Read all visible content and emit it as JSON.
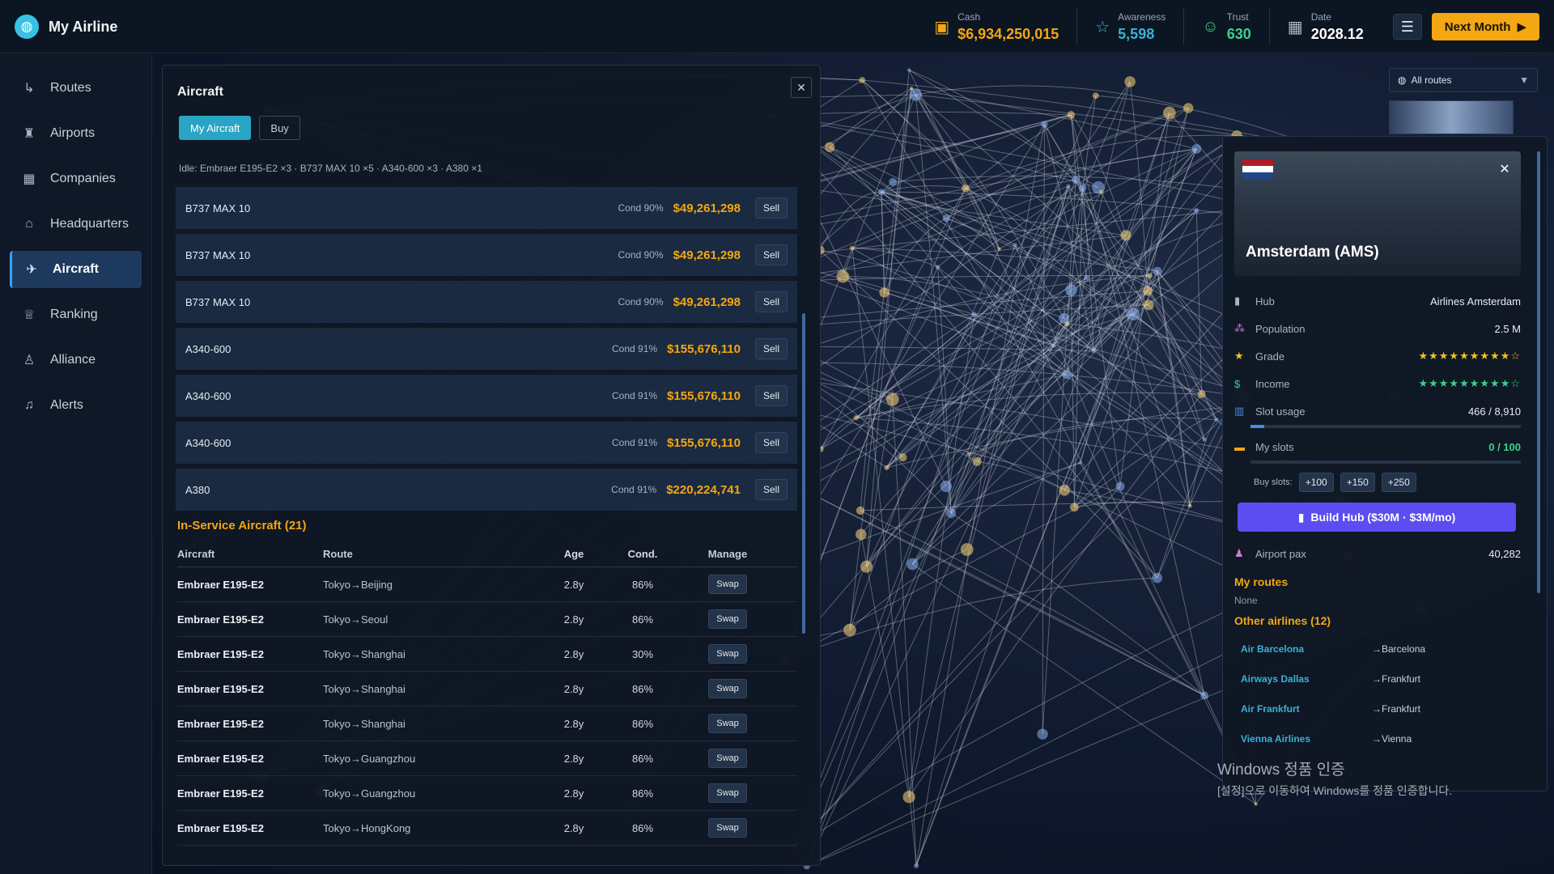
{
  "app": {
    "title": "My Airline"
  },
  "stats": {
    "cash": {
      "label": "Cash",
      "value": "$6,934,250,015",
      "color": "#f3a712"
    },
    "awareness": {
      "label": "Awareness",
      "value": "5,598",
      "color": "#38b2d8"
    },
    "trust": {
      "label": "Trust",
      "value": "630",
      "color": "#3ecf8e"
    },
    "date": {
      "label": "Date",
      "value": "2028.12",
      "color": "#ffffff"
    }
  },
  "topbar": {
    "next_month_label": "Next Month"
  },
  "sidebar": {
    "items": [
      {
        "label": "Routes",
        "icon": "route-icon"
      },
      {
        "label": "Airports",
        "icon": "airport-icon"
      },
      {
        "label": "Companies",
        "icon": "building-icon"
      },
      {
        "label": "Headquarters",
        "icon": "home-icon"
      },
      {
        "label": "Aircraft",
        "icon": "plane-icon",
        "active": true
      },
      {
        "label": "Ranking",
        "icon": "trophy-icon"
      },
      {
        "label": "Alliance",
        "icon": "user-icon"
      },
      {
        "label": "Alerts",
        "icon": "bell-icon"
      }
    ]
  },
  "aircraft_panel": {
    "title": "Aircraft",
    "tabs": [
      "My Aircraft",
      "Buy"
    ],
    "idle_summary": "Idle: Embraer E195-E2 ×3 · B737 MAX 10 ×5 · A340-600 ×3 · A380 ×1",
    "sell_label": "Sell",
    "for_sale": [
      {
        "name": "B737 MAX 10",
        "cond": "Cond 90%",
        "price": "$49,261,298"
      },
      {
        "name": "B737 MAX 10",
        "cond": "Cond 90%",
        "price": "$49,261,298"
      },
      {
        "name": "B737 MAX 10",
        "cond": "Cond 90%",
        "price": "$49,261,298"
      },
      {
        "name": "A340-600",
        "cond": "Cond 91%",
        "price": "$155,676,110"
      },
      {
        "name": "A340-600",
        "cond": "Cond 91%",
        "price": "$155,676,110"
      },
      {
        "name": "A340-600",
        "cond": "Cond 91%",
        "price": "$155,676,110"
      },
      {
        "name": "A380",
        "cond": "Cond 91%",
        "price": "$220,224,741"
      }
    ],
    "in_service_title": "In-Service Aircraft (21)",
    "columns": [
      "Aircraft",
      "Route",
      "Age",
      "Cond.",
      "Manage"
    ],
    "swap_label": "Swap",
    "in_service": [
      {
        "aircraft": "Embraer E195-E2",
        "route": "Tokyo→Beijing",
        "age": "2.8y",
        "cond": "86%"
      },
      {
        "aircraft": "Embraer E195-E2",
        "route": "Tokyo→Seoul",
        "age": "2.8y",
        "cond": "86%"
      },
      {
        "aircraft": "Embraer E195-E2",
        "route": "Tokyo→Shanghai",
        "age": "2.8y",
        "cond": "30%"
      },
      {
        "aircraft": "Embraer E195-E2",
        "route": "Tokyo→Shanghai",
        "age": "2.8y",
        "cond": "86%"
      },
      {
        "aircraft": "Embraer E195-E2",
        "route": "Tokyo→Shanghai",
        "age": "2.8y",
        "cond": "86%"
      },
      {
        "aircraft": "Embraer E195-E2",
        "route": "Tokyo→Guangzhou",
        "age": "2.8y",
        "cond": "86%"
      },
      {
        "aircraft": "Embraer E195-E2",
        "route": "Tokyo→Guangzhou",
        "age": "2.8y",
        "cond": "86%"
      },
      {
        "aircraft": "Embraer E195-E2",
        "route": "Tokyo→HongKong",
        "age": "2.8y",
        "cond": "86%"
      }
    ]
  },
  "route_filter": {
    "value": "All routes"
  },
  "airport": {
    "name": "Amsterdam (AMS)",
    "flag_colors": [
      "#ae1c28",
      "#ffffff",
      "#21468b"
    ],
    "hub_label": "Hub",
    "hub_value": "Airlines Amsterdam",
    "population_label": "Population",
    "population_value": "2.5 M",
    "grade_label": "Grade",
    "grade_stars": 9,
    "grade_max": 10,
    "income_label": "Income",
    "income_stars": 9,
    "income_max": 10,
    "slot_usage_label": "Slot usage",
    "slot_usage_value": "466 / 8,910",
    "slot_usage_fraction": 0.052,
    "my_slots_label": "My slots",
    "my_slots_value": "0 / 100",
    "my_slots_fraction": 0,
    "buy_slots_label": "Buy slots:",
    "buy_slot_options": [
      "+100",
      "+150",
      "+250"
    ],
    "build_hub_label": "Build Hub ($30M · $3M/mo)",
    "airport_pax_label": "Airport pax",
    "airport_pax_value": "40,282",
    "my_routes_title": "My routes",
    "my_routes_empty": "None",
    "other_airlines_title": "Other airlines (12)",
    "other_airlines": [
      {
        "name": "Air Barcelona",
        "dest": "→Barcelona"
      },
      {
        "name": "Airways Dallas",
        "dest": "→Frankfurt"
      },
      {
        "name": "Air Frankfurt",
        "dest": "→Frankfurt"
      },
      {
        "name": "Vienna Airlines",
        "dest": "→Vienna"
      }
    ]
  },
  "watermark": {
    "line1": "Windows 정품 인증",
    "line2": "[설정]으로 이동하여 Windows를 정품 인증합니다."
  }
}
